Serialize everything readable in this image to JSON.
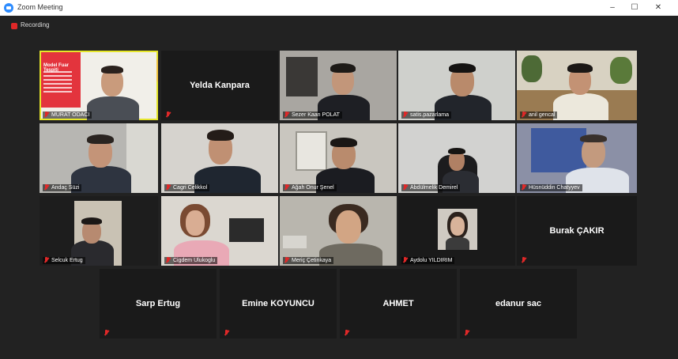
{
  "window": {
    "title": "Zoom Meeting",
    "minimize": "–",
    "maximize": "☐",
    "close": "✕"
  },
  "recording": {
    "label": "Recording"
  },
  "slide": {
    "title": "Model Fuar Tespiti"
  },
  "participants": [
    {
      "name": "MURAT ODACI",
      "video": true
    },
    {
      "name": "Yelda Kanpara",
      "video": false
    },
    {
      "name": "Sezer Kaan POLAT",
      "video": true
    },
    {
      "name": "satis.pazarlama",
      "video": true
    },
    {
      "name": "anil gencal",
      "video": true
    },
    {
      "name": "Andaç Süzi",
      "video": true
    },
    {
      "name": "Cagri Celikkol",
      "video": true
    },
    {
      "name": "Ağah Onur Şenel",
      "video": true
    },
    {
      "name": "Abdülmelik Demirel",
      "video": true
    },
    {
      "name": "Hüsnüddin Chatyyev",
      "video": true
    },
    {
      "name": "Selcuk Ertug",
      "video": true
    },
    {
      "name": "Cigdem Ulukoglu",
      "video": true
    },
    {
      "name": "Meriç Çetinkaya",
      "video": true
    },
    {
      "name": "Aydolu YILDIRIM",
      "video": true
    },
    {
      "name": "Burak ÇAKIR",
      "video": false
    },
    {
      "name": "Sarp Ertug",
      "video": false
    },
    {
      "name": "Emine KOYUNCU",
      "video": false
    },
    {
      "name": "AHMET",
      "video": false
    },
    {
      "name": "edanur sac",
      "video": false
    }
  ]
}
